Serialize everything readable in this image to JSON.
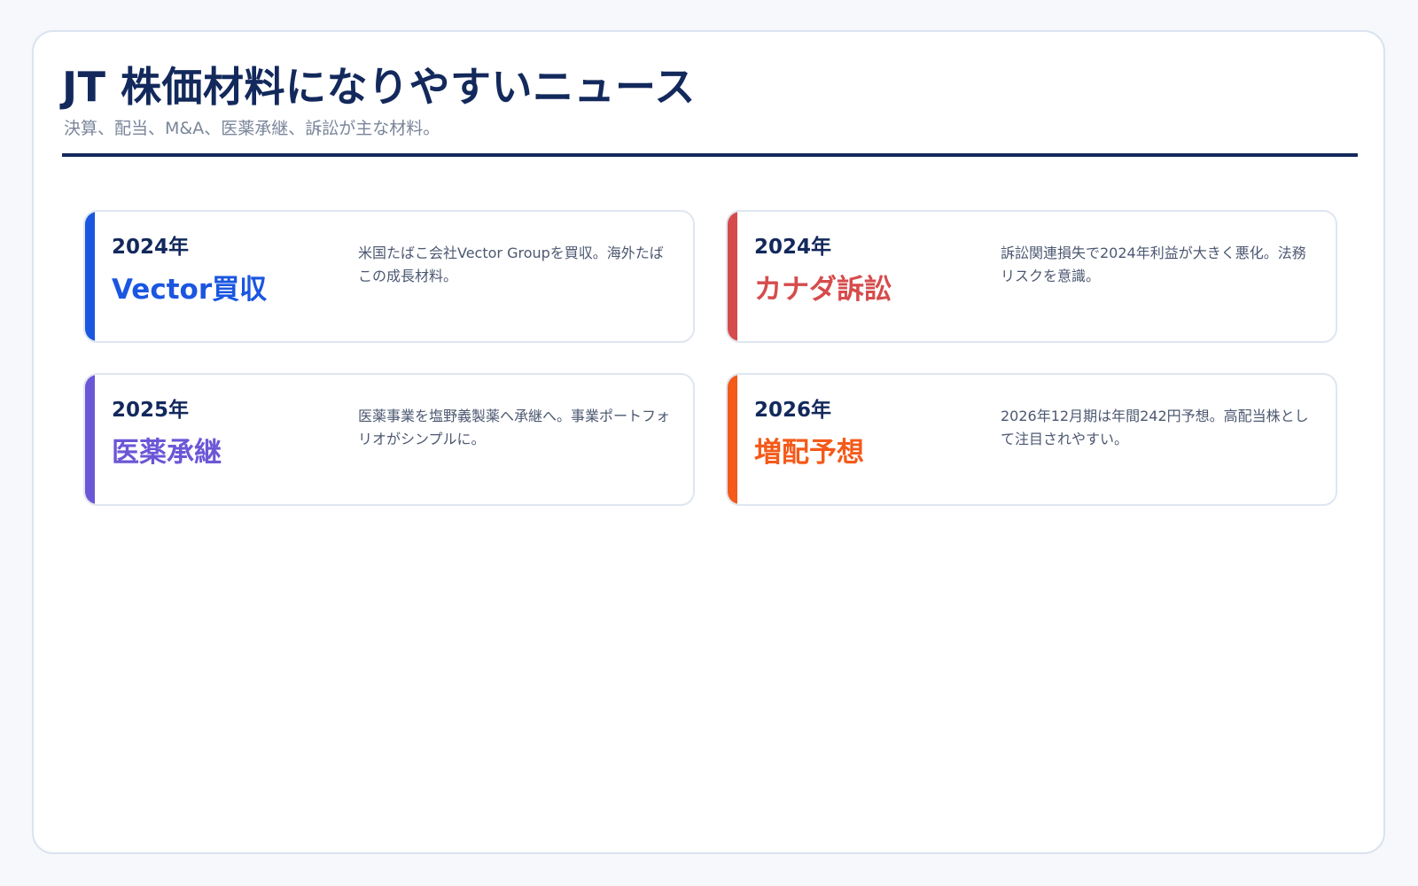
{
  "header": {
    "title": "JT 株価材料になりやすいニュース",
    "subtitle": "決算、配当、M&A、医薬承継、訴訟が主な材料。"
  },
  "cards": [
    {
      "year": "2024年",
      "headline": "Vector買収",
      "description": "米国たばこ会社Vector Groupを買収。海外たばこの成長材料。",
      "accent_color": "#1a56e0"
    },
    {
      "year": "2024年",
      "headline": "カナダ訴訟",
      "description": "訴訟関連損失で2024年利益が大きく悪化。法務リスクを意識。",
      "accent_color": "#d64c4c"
    },
    {
      "year": "2025年",
      "headline": "医薬承継",
      "description": "医薬事業を塩野義製薬へ承継へ。事業ポートフォリオがシンプルに。",
      "accent_color": "#6b57d6"
    },
    {
      "year": "2026年",
      "headline": "増配予想",
      "description": "2026年12月期は年間242円予想。高配当株として注目されやすい。",
      "accent_color": "#f45a1a"
    }
  ]
}
